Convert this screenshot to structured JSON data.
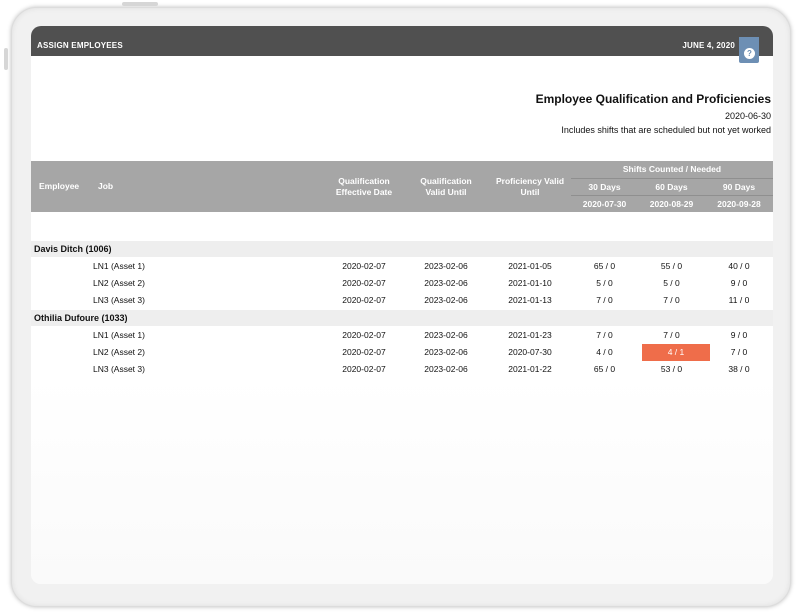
{
  "window": {
    "title": "ASSIGN EMPLOYEES",
    "date": "JUNE 4, 2020",
    "help_icon": "?"
  },
  "report": {
    "title": "Employee Qualification and Proficiencies",
    "date": "2020-06-30",
    "note": "Includes shifts that are scheduled but not yet worked"
  },
  "columns": {
    "employee": "Employee",
    "job": "Job",
    "qual_effective": "Qualification Effective Date",
    "qual_valid": "Qualification Valid Until",
    "prof_valid": "Proficiency Valid Until",
    "shifts_group": "Shifts Counted / Needed",
    "d30": "30 Days",
    "d60": "60 Days",
    "d90": "90 Days",
    "d30_date": "2020-07-30",
    "d60_date": "2020-08-29",
    "d90_date": "2020-09-28"
  },
  "groups": [
    {
      "name": "Davis Ditch (1006)",
      "rows": [
        {
          "job": "LN1 (Asset 1)",
          "qe": "2020-02-07",
          "qv": "2023-02-06",
          "pv": "2021-01-05",
          "s30": "65 / 0",
          "s60": "55 / 0",
          "s90": "40 / 0"
        },
        {
          "job": "LN2 (Asset 2)",
          "qe": "2020-02-07",
          "qv": "2023-02-06",
          "pv": "2021-01-10",
          "s30": "5 / 0",
          "s60": "5 / 0",
          "s90": "9 / 0"
        },
        {
          "job": "LN3 (Asset 3)",
          "qe": "2020-02-07",
          "qv": "2023-02-06",
          "pv": "2021-01-13",
          "s30": "7 / 0",
          "s60": "7 / 0",
          "s90": "11 / 0"
        }
      ]
    },
    {
      "name": "Othilia Dufoure (1033)",
      "rows": [
        {
          "job": "LN1 (Asset 1)",
          "qe": "2020-02-07",
          "qv": "2023-02-06",
          "pv": "2021-01-23",
          "s30": "7 / 0",
          "s60": "7 / 0",
          "s90": "9 / 0"
        },
        {
          "job": "LN2 (Asset 2)",
          "qe": "2020-02-07",
          "qv": "2023-02-06",
          "pv": "2020-07-30",
          "s30": "4 / 0",
          "s60": "4 / 1",
          "s90": "7 / 0"
        },
        {
          "job": "LN3 (Asset 3)",
          "qe": "2020-02-07",
          "qv": "2023-02-06",
          "pv": "2021-01-22",
          "s30": "65 / 0",
          "s60": "53 / 0",
          "s90": "38 / 0"
        }
      ]
    }
  ],
  "colors": {
    "titlebar": "#505050",
    "header": "#a6a6a6",
    "highlight": "#ef6d4a",
    "help": "#6d8fb4"
  }
}
